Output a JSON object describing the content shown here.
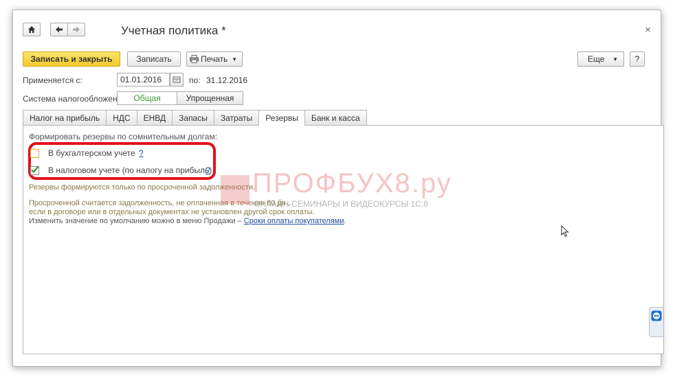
{
  "window": {
    "title": "Учетная политика *",
    "close_glyph": "×"
  },
  "toolbar": {
    "save_close_label": "Записать и закрыть",
    "save_label": "Записать",
    "print_label": "Печать",
    "more_label": "Еще",
    "help_label": "?"
  },
  "period": {
    "applies_label": "Применяется с:",
    "date_from": "01.01.2016",
    "to_label": "по:",
    "date_to": "31.12.2016"
  },
  "tax_system": {
    "label": "Система налогообложения:",
    "options": [
      "Общая",
      "Упрощенная"
    ],
    "selected": "Общая"
  },
  "tabs": [
    "Налог на прибыль",
    "НДС",
    "ЕНВД",
    "Запасы",
    "Затраты",
    "Резервы",
    "Банк и касса"
  ],
  "active_tab": "Резервы",
  "reserves": {
    "heading": "Формировать резервы по сомнительным долгам:",
    "accounting_label": "В бухгалтерском учете",
    "accounting_checked": false,
    "tax_label": "В налоговом учете (по налогу на прибыль)",
    "tax_checked": true,
    "help_q": "?",
    "note1": "Резервы формируются только по просроченной задолженности.",
    "note2_a": "Просроченной считается задолженность, не оплаченная в течение 60 дн.,",
    "note2_b": "если в договоре или в отдельных документах не установлен другой срок оплаты.",
    "note2_c": "Изменить значение по умолчанию можно в меню Продажи –",
    "note2_link": "Сроки оплаты покупателями",
    "note2_end": "."
  },
  "watermark": {
    "brand": "ПРОФБУХ8.ру",
    "tagline": "ОНЛАЙН-СЕМИНАРЫ И ВИДЕОКУРСЫ 1С:8"
  },
  "colors": {
    "primary_button": "#f3c92b",
    "highlight_frame": "#e4101c",
    "link": "#1f4fa0",
    "selected_option_text": "#3a9a3a"
  }
}
